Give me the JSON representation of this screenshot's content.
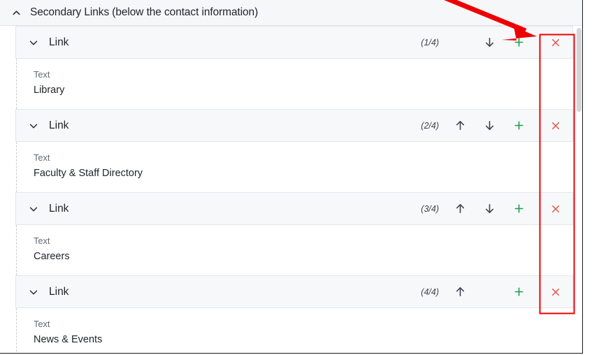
{
  "section": {
    "title": "Secondary Links (below the contact information)",
    "collapse_icon": "chevron-up-icon",
    "expanded": true
  },
  "field_label": "Text",
  "icons": {
    "expand": "chevron-down-icon",
    "move_up": "arrow-up-icon",
    "move_down": "arrow-down-icon",
    "add": "plus-icon",
    "remove": "close-x-icon"
  },
  "colors": {
    "header_bg": "#f6f7f9",
    "row_bg": "#f7f8fa",
    "border": "#e4e6ea",
    "text": "#1f2329",
    "muted": "#646b75",
    "add_green": "#1e9e4a",
    "remove_red": "#e2574c",
    "annotation_red": "#ee0000"
  },
  "items": [
    {
      "title": "Link",
      "counter": "(1/4)",
      "has_up": false,
      "has_down": true,
      "add_label": "+",
      "remove_label": "×",
      "field_label": "Text",
      "field_value": "Library"
    },
    {
      "title": "Link",
      "counter": "(2/4)",
      "has_up": true,
      "has_down": true,
      "add_label": "+",
      "remove_label": "×",
      "field_label": "Text",
      "field_value": "Faculty & Staff Directory"
    },
    {
      "title": "Link",
      "counter": "(3/4)",
      "has_up": true,
      "has_down": true,
      "add_label": "+",
      "remove_label": "×",
      "field_label": "Text",
      "field_value": "Careers"
    },
    {
      "title": "Link",
      "counter": "(4/4)",
      "has_up": true,
      "has_down": false,
      "add_label": "+",
      "remove_label": "×",
      "field_label": "Text",
      "field_value": "News & Events"
    }
  ],
  "annotation": {
    "type": "arrow-and-highlight",
    "arrow_color": "#ee0000",
    "highlight_color": "#ee0000",
    "points_to": "remove-button-column"
  }
}
